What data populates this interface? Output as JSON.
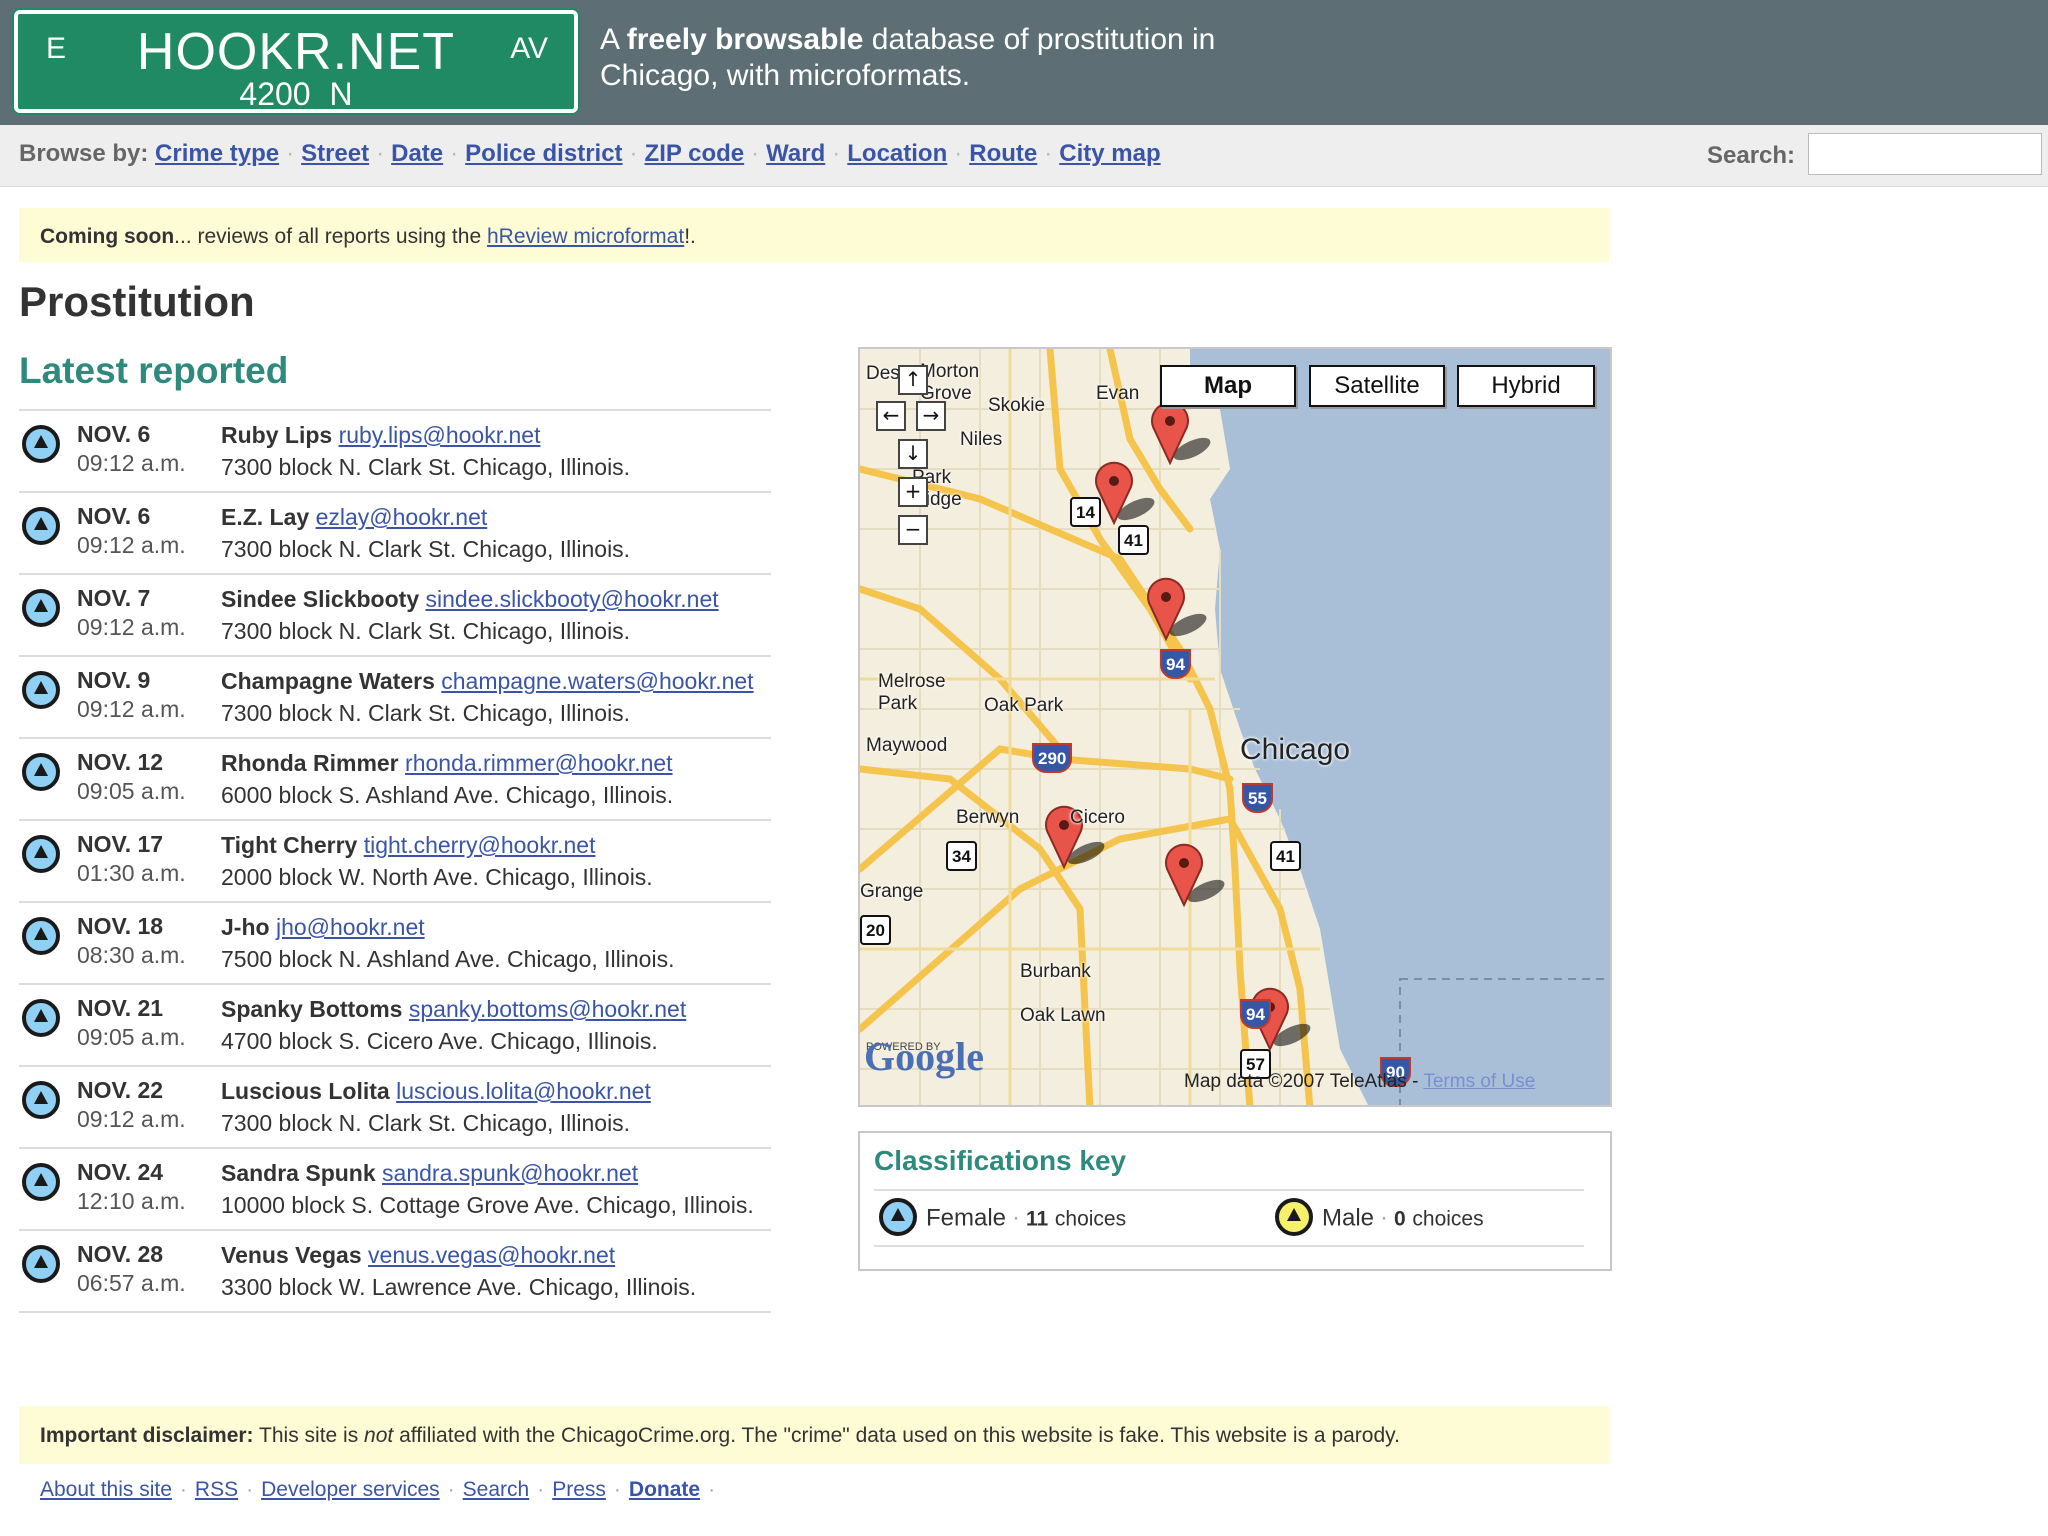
{
  "header": {
    "sign": {
      "dir_left": "E",
      "name": "HOOKR.NET",
      "dir_right": "AV",
      "number": "4200 N"
    },
    "tagline_prefix": "A ",
    "tagline_bold": "freely browsable",
    "tagline_rest": " database of prostitution in Chicago, with microformats."
  },
  "nav": {
    "browse_label": "Browse by:",
    "items": [
      "Crime type",
      "Street",
      "Date",
      "Police district",
      "ZIP code",
      "Ward",
      "Location",
      "Route",
      "City map"
    ],
    "search_label": "Search:",
    "search_value": ""
  },
  "notice_top": {
    "bold": "Coming soon",
    "text": "... reviews of all reports using the ",
    "link": "hReview microformat",
    "end": "!."
  },
  "page_title": "Prostitution",
  "latest_heading": "Latest reported",
  "reports": [
    {
      "date": "NOV. 6",
      "time": "09:12 a.m.",
      "name": "Ruby Lips",
      "email": "ruby.lips@hookr.net",
      "address": "7300 block N. Clark St. Chicago, Illinois.",
      "sex": "female"
    },
    {
      "date": "NOV. 6",
      "time": "09:12 a.m.",
      "name": "E.Z. Lay",
      "email": "ezlay@hookr.net",
      "address": "7300 block N. Clark St. Chicago, Illinois.",
      "sex": "female"
    },
    {
      "date": "NOV. 7",
      "time": "09:12 a.m.",
      "name": "Sindee Slickbooty",
      "email": "sindee.slickbooty@hookr.net",
      "address": "7300 block N. Clark St. Chicago, Illinois.",
      "sex": "female"
    },
    {
      "date": "NOV. 9",
      "time": "09:12 a.m.",
      "name": "Champagne Waters",
      "email": "champagne.waters@hookr.net",
      "address": "7300 block N. Clark St. Chicago, Illinois.",
      "sex": "female"
    },
    {
      "date": "NOV. 12",
      "time": "09:05 a.m.",
      "name": "Rhonda Rimmer",
      "email": "rhonda.rimmer@hookr.net",
      "address": "6000 block S. Ashland Ave. Chicago, Illinois.",
      "sex": "female"
    },
    {
      "date": "NOV. 17",
      "time": "01:30 a.m.",
      "name": "Tight Cherry",
      "email": "tight.cherry@hookr.net",
      "address": "2000 block W. North Ave. Chicago, Illinois.",
      "sex": "female"
    },
    {
      "date": "NOV. 18",
      "time": "08:30 a.m.",
      "name": "J-ho",
      "email": "jho@hookr.net",
      "address": "7500 block N. Ashland Ave. Chicago, Illinois.",
      "sex": "female"
    },
    {
      "date": "NOV. 21",
      "time": "09:05 a.m.",
      "name": "Spanky Bottoms",
      "email": "spanky.bottoms@hookr.net",
      "address": "4700 block S. Cicero Ave. Chicago, Illinois.",
      "sex": "female"
    },
    {
      "date": "NOV. 22",
      "time": "09:12 a.m.",
      "name": "Luscious Lolita",
      "email": "luscious.lolita@hookr.net",
      "address": "7300 block N. Clark St. Chicago, Illinois.",
      "sex": "female"
    },
    {
      "date": "NOV. 24",
      "time": "12:10 a.m.",
      "name": "Sandra Spunk",
      "email": "sandra.spunk@hookr.net",
      "address": "10000 block S. Cottage Grove Ave. Chicago, Illinois.",
      "sex": "female"
    },
    {
      "date": "NOV. 28",
      "time": "06:57 a.m.",
      "name": "Venus Vegas",
      "email": "venus.vegas@hookr.net",
      "address": "3300 block W. Lawrence Ave. Chicago, Illinois.",
      "sex": "female"
    }
  ],
  "map": {
    "buttons": {
      "map": "Map",
      "satellite": "Satellite",
      "hybrid": "Hybrid"
    },
    "labels": [
      "Des",
      "Morton Grove",
      "Evan",
      "Skokie",
      "Niles",
      "Park Ridge",
      "Melrose Park",
      "Oak Park",
      "Maywood",
      "Chicago",
      "Berwyn",
      "Cicero",
      "Grange",
      "Burbank",
      "Oak Lawn"
    ],
    "shields": [
      "14",
      "41",
      "94",
      "290",
      "55",
      "34",
      "41",
      "20",
      "94",
      "57",
      "90"
    ],
    "powered_by": "POWERED BY",
    "google": "Google",
    "copyright": "Map data ©2007 TeleAtlas - ",
    "terms": "Terms of Use",
    "colors": {
      "water": "#a9bfd8",
      "land": "#f4eede",
      "road": "#f5c44c",
      "pin": "#e8534a"
    }
  },
  "key": {
    "title": "Classifications key",
    "female_label": "Female",
    "female_count": "11",
    "female_suffix": "choices",
    "male_label": "Male",
    "male_count": "0",
    "male_suffix": "choices"
  },
  "disclaimer": {
    "bold": "Important disclaimer:",
    "text1": " This site is ",
    "em": "not",
    "text2": " affiliated with the ChicagoCrime.org. The \"crime\" data used on this website is fake. This website is a parody."
  },
  "footer_links": [
    "About this site",
    "RSS",
    "Developer services",
    "Search",
    "Press",
    "Donate"
  ]
}
